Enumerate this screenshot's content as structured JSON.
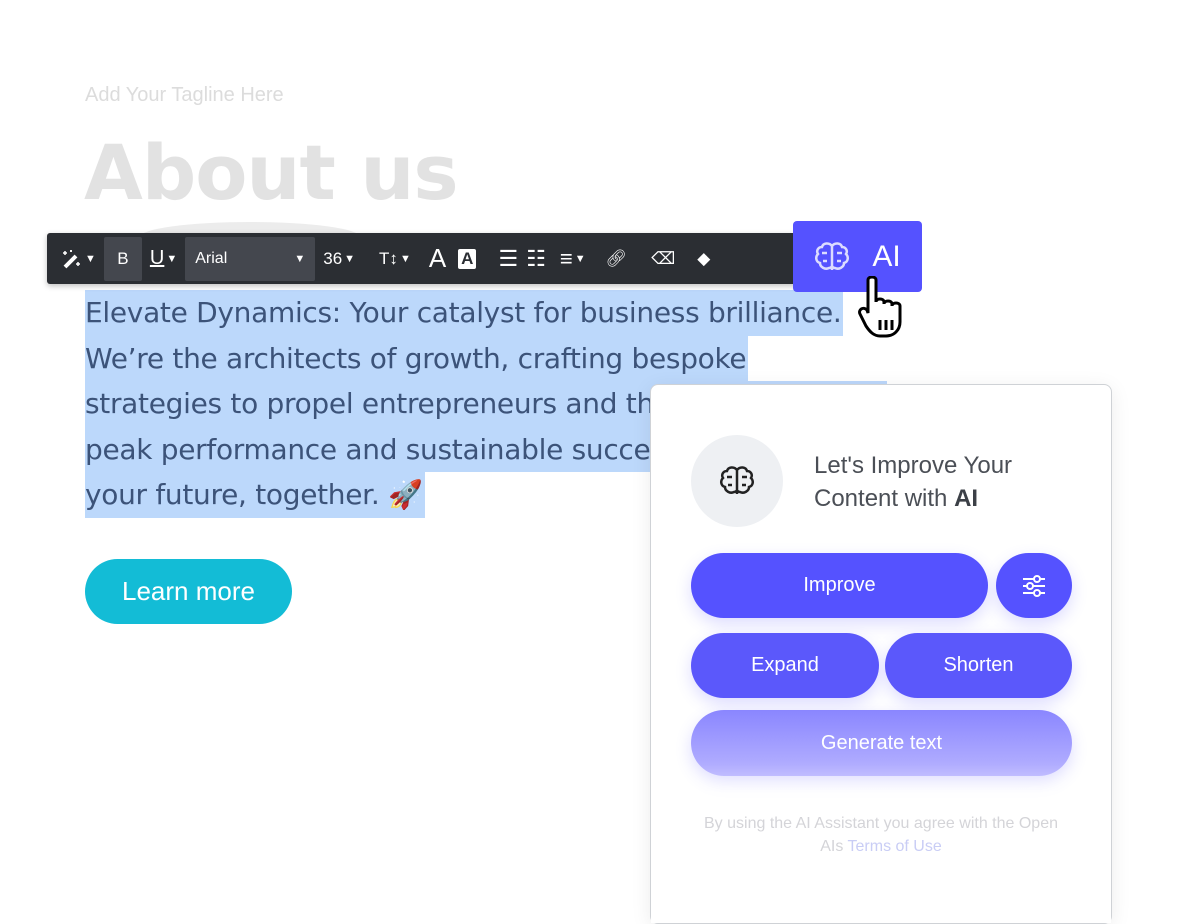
{
  "page": {
    "tagline": "Add Your Tagline Here",
    "heading": "About us",
    "body_lines": [
      "Elevate Dynamics: Your catalyst for business brilliance.",
      "We’re the architects of growth, crafting bespoke",
      "strategies to propel entrepreneurs and their businesses to",
      "peak performance and sustainable success. Let's shape",
      "your future, together. 🚀"
    ],
    "learn_more": "Learn more"
  },
  "toolbar": {
    "font": "Arial",
    "size": "36",
    "bold": "B",
    "underline": "U",
    "ai_label": "AI",
    "icons": [
      "magic-wand-icon",
      "bold-icon",
      "underline-icon",
      "text-height-icon",
      "text-color-icon",
      "text-highlight-icon",
      "bullet-list-icon",
      "numbered-list-icon",
      "align-icon",
      "link-icon",
      "eraser-icon",
      "tag-icon",
      "brain-icon"
    ]
  },
  "ai_panel": {
    "title_1": "Let's Improve Your",
    "title_2": "Content with ",
    "title_bold": "AI",
    "improve": "Improve",
    "expand": "Expand",
    "shorten": "Shorten",
    "generate": "Generate text",
    "terms_text": "By using the AI Assistant you agree with the Open AIs ",
    "terms_link": "Terms of Use"
  },
  "colors": {
    "accent": "#5552ff",
    "cta": "#13bcd6",
    "selection": "#bcd8fb",
    "toolbar": "#2b2e33"
  }
}
